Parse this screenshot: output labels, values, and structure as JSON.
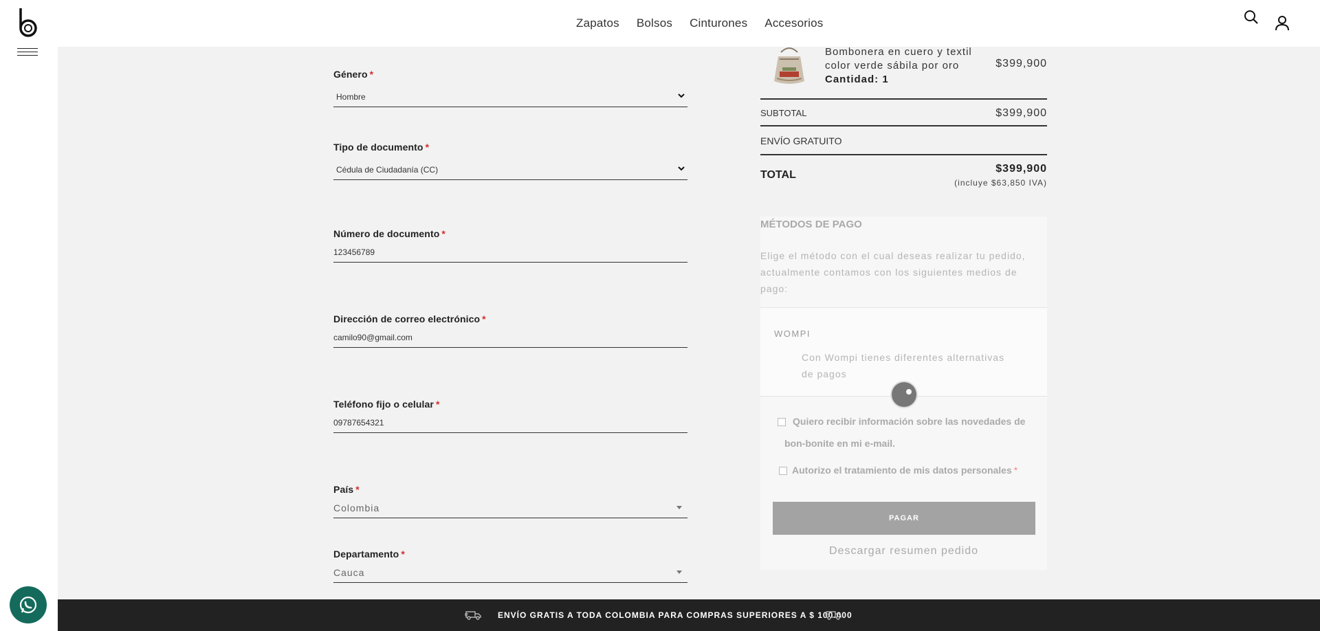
{
  "header": {
    "nav": [
      "Zapatos",
      "Bolsos",
      "Cinturones",
      "Accesorios"
    ]
  },
  "form": {
    "gender": {
      "label": "Género",
      "value": "Hombre"
    },
    "doc_type": {
      "label": "Tipo de documento",
      "value": "Cédula de Ciudadanía (CC)"
    },
    "doc_number": {
      "label": "Número de documento",
      "value": "123456789"
    },
    "email": {
      "label": "Dirección de correo electrónico",
      "value": "camilo90@gmail.com"
    },
    "phone": {
      "label": "Teléfono fijo o celular",
      "value": "09787654321"
    },
    "country": {
      "label": "País",
      "value": "Colombia"
    },
    "department": {
      "label": "Departamento",
      "value": "Cauca"
    },
    "required_mark": "*"
  },
  "summary": {
    "product": {
      "name": "Bombonera en cuero y textil color verde sábila por oro",
      "qty_label": "Cantidad: 1",
      "price": "$399,900"
    },
    "subtotal_label": "SUBTOTAL",
    "subtotal_value": "$399,900",
    "shipping_label": "ENVÍO GRATUITO",
    "total_label": "TOTAL",
    "total_value": "$399,900",
    "total_iva": "(incluye $63,850 IVA)"
  },
  "payment": {
    "title": "MÉTODOS DE PAGO",
    "description": "Elige el método con el cual deseas realizar tu pedido, actualmente contamos con los siguientes medios de pago:",
    "method_name": "WOMPI",
    "method_desc": "Con Wompi tienes diferentes alternativas de pagos",
    "newsletter_text": "Quiero recibir información sobre las novedades de bon-bonite en mi e-mail.",
    "privacy_text": "Autorizo el tratamiento de mis datos personales",
    "pay_button": "PAGAR",
    "download_link": "Descargar resumen pedido"
  },
  "footer": {
    "banner": "ENVÍO GRATIS A TODA COLOMBIA PARA COMPRAS SUPERIORES A $ 100.000"
  },
  "icons": {
    "logo": "bon-bonite-logo",
    "menu": "hamburger-icon",
    "search": "search-icon",
    "account": "user-icon",
    "whatsapp": "whatsapp-icon",
    "truck": "truck-icon"
  }
}
